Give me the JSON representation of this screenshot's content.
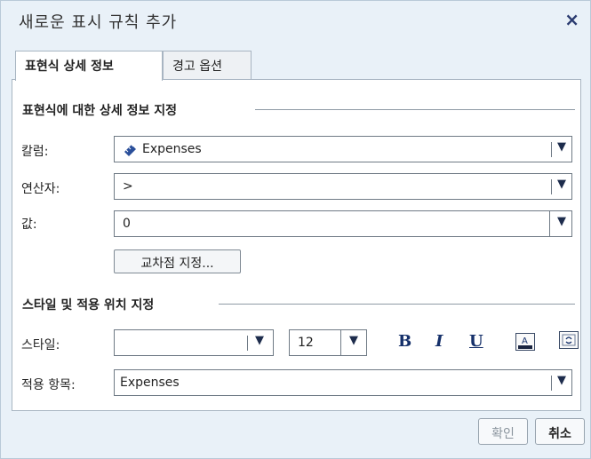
{
  "dialog": {
    "title": "새로운 표시 규칙 추가",
    "close_icon": "×"
  },
  "tabs": [
    {
      "label": "표현식 상세 정보",
      "active": true
    },
    {
      "label": "경고 옵션",
      "active": false
    }
  ],
  "expression_section": {
    "heading": "표현식에 대한 상세 정보 지정",
    "column_label": "칼럼:",
    "column_value": "Expenses",
    "column_icon": "measure-icon",
    "operator_label": "연산자:",
    "operator_value": ">",
    "value_label": "값:",
    "value_value": "0",
    "intersection_button": "교차점 지정..."
  },
  "style_section": {
    "heading": "스타일 및 적용 위치 지정",
    "style_label": "스타일:",
    "style_value": "",
    "font_size": "12",
    "bold": "B",
    "italic": "I",
    "underline": "U",
    "apply_label": "적용 항목:",
    "apply_value": "Expenses"
  },
  "footer": {
    "ok": "확인",
    "cancel": "취소"
  },
  "colors": {
    "accent": "#15306a",
    "border": "#a8b5c2",
    "background": "#e9f1f8"
  }
}
